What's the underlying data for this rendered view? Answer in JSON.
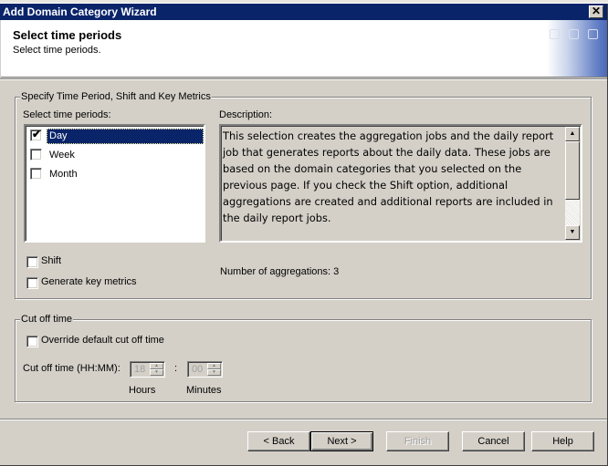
{
  "window": {
    "title": "Add Domain Category Wizard",
    "close_glyph": "✕"
  },
  "header": {
    "title": "Select time periods",
    "subtitle": "Select time periods."
  },
  "period_group": {
    "legend": "Specify Time Period, Shift and Key Metrics",
    "list_label": "Select time periods:",
    "items": [
      {
        "label": "Day",
        "checked": true,
        "selected": true
      },
      {
        "label": "Week",
        "checked": false,
        "selected": false
      },
      {
        "label": "Month",
        "checked": false,
        "selected": false
      }
    ],
    "description_label": "Description:",
    "description_text": "This selection creates the aggregation jobs and the daily report job that generates reports about the daily data. These jobs are based on the domain categories that you selected on the previous page. If you check the Shift option, additional aggregations are created and additional reports are included in the daily report jobs.",
    "shift_label": "Shift",
    "shift_checked": false,
    "key_metrics_label": "Generate key metrics",
    "key_metrics_checked": false,
    "aggregations_text": "Number of aggregations:  3"
  },
  "cutoff_group": {
    "legend": "Cut off time",
    "override_label": "Override default cut off time",
    "override_checked": false,
    "time_label": "Cut off time (HH:MM):",
    "hours_value": "18",
    "minutes_value": "00",
    "separator": ":",
    "hours_caption": "Hours",
    "minutes_caption": "Minutes"
  },
  "buttons": {
    "back": "< Back",
    "next": "Next >",
    "finish": "Finish",
    "cancel": "Cancel",
    "help": "Help"
  },
  "icons": {
    "check": "✔",
    "scroll_up": "▲",
    "scroll_down": "▼"
  }
}
